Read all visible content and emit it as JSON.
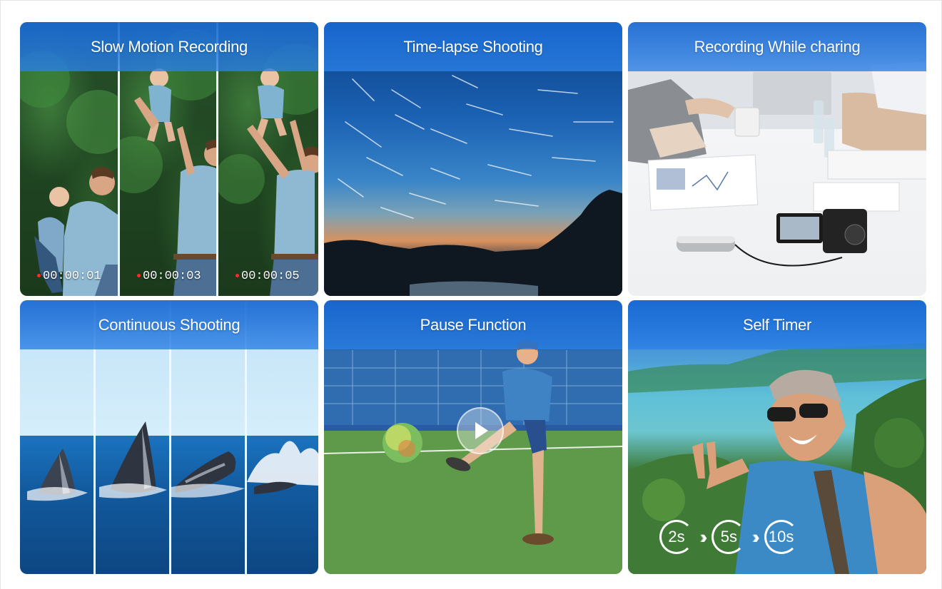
{
  "tiles": [
    {
      "title": "Slow Motion Recording",
      "timecodes": [
        "00:00:01",
        "00:00:03",
        "00:00:05"
      ]
    },
    {
      "title": "Time-lapse Shooting"
    },
    {
      "title": "Recording While charing"
    },
    {
      "title": "Continuous Shooting"
    },
    {
      "title": "Pause Function"
    },
    {
      "title": "Self Timer",
      "timers": [
        "2s",
        "5s",
        "10s"
      ]
    }
  ],
  "colors": {
    "banner": "#1868d2",
    "accent_white": "#ffffff",
    "rec_dot": "#ff2a2a"
  },
  "icons": {
    "play": "play-icon",
    "timer": "timer-icon",
    "chevrons": "chevron-right-icon"
  }
}
